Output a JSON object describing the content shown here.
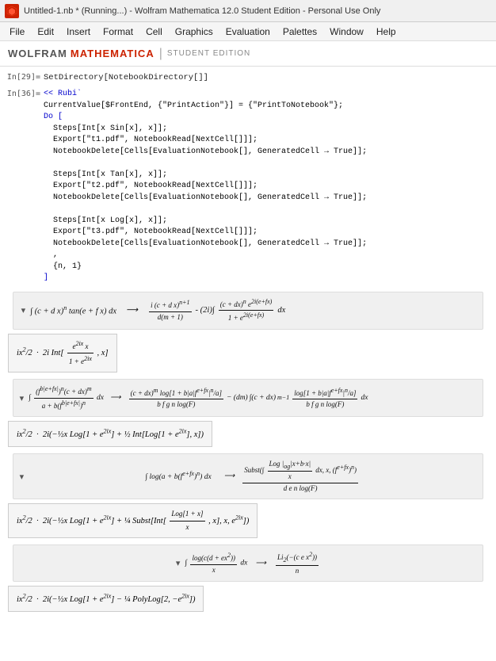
{
  "titleBar": {
    "title": "Untitled-1.nb * (Running...) - Wolfram Mathematica 12.0 Student Edition - Personal Use Only",
    "personalUse": "Personal Use Only"
  },
  "menuBar": {
    "items": [
      "File",
      "Edit",
      "Insert",
      "Format",
      "Cell",
      "Graphics",
      "Evaluation",
      "Palettes",
      "Window",
      "Help"
    ]
  },
  "wolframHeader": {
    "wolfram": "WOLFRAM",
    "mathematica": "MATHEMATICA",
    "separator": "|",
    "edition": "STUDENT EDITION"
  },
  "cells": [
    {
      "label": "In[29]=",
      "code": "SetDirectory[NotebookDirectory[]]"
    },
    {
      "label": "In[36]=",
      "code": "<< Rubi`\nCurrentValue[$FrontEnd, {\"PrintAction\"}] = {\"PrintToNotebook\"};\nDo[\n  Steps[Int[x Sin[x], x]];\n  Export[\"t1.pdf\", NotebookRead[NextCell[]]];\n  NotebookDelete[Cells[EvaluationNotebook[], GeneratedCell -> True]];\n\n  Steps[Int[x Tan[x], x]];\n  Export[\"t2.pdf\", NotebookRead[NextCell[]]];\n  NotebookDelete[Cells[EvaluationNotebook[], GeneratedCell -> True]];\n\n  Steps[Int[x Log[x], x]];\n  Export[\"t3.pdf\", NotebookRead[NextCell[]]];\n  NotebookDelete[Cells[EvaluationNotebook[], GeneratedCell -> True]];\n  ,\n  {n, 1}\n]"
    }
  ],
  "mathOutputs": [
    {
      "id": "out1",
      "type": "chevron",
      "left": "∫ (c + d x)ⁿ tan(e + f x) dx",
      "arrow": "→",
      "right1": "i (c + d x)ⁿ⁺¹ / (d(m+1)) - (2i) ∫ (c+dx)ⁿ e²ⁱ⁽ᵉ⁺ᶠˣ⁾ / (1 + e²ⁱ⁽ᵉ⁺ᶠˣ⁾) dx"
    },
    {
      "id": "out1b",
      "type": "small-box",
      "content": "ix²/2 · 2i Int[e²ⁱˣ x / (1 + e²ⁱˣ), x]"
    },
    {
      "id": "out2",
      "type": "chevron",
      "left": "∫ (fᵇ|ᵉ⁺ᶠˣ|)ⁿ (c+dx)ᵐ / (a + b(fᵇ|ᵉ⁺ᶠˣ|)ⁿ) dx",
      "arrow": "→",
      "right1": "(c+dx)ᵐ log[1 + b|a|fᵉ⁺ᶠˣ|ⁿ/a] / bfgn log(F) - (dm) ∫(c+dx)ᵐ⁻¹ log[...] dx / bfgn log(F)"
    },
    {
      "id": "out2b",
      "type": "small-box",
      "content": "ix²/2 · 2i(-½ x Log[1+e²ⁱˣ] + ½ Int[Log[1+e²ⁱˣ], x])"
    },
    {
      "id": "out3",
      "type": "chevron",
      "left": "∫ log(a + b(fᵉ⁺ᶠˣ|)ⁿ) dx",
      "arrow": "→",
      "right1": "Subst(∫ Log(|og|x+b·x|/x) dx, x, (fᵉ⁺ᶠˣ)ⁿ) / den log(F)"
    },
    {
      "id": "out3b",
      "type": "small-box",
      "content": "ix²/2 · 2i(-½ x Log[1+e²ⁱˣ] + ¼ Subst[Int[Log[1+x]/x, x], x, e²ⁱˣ])"
    },
    {
      "id": "out4",
      "type": "chevron",
      "left": "∫ log(c(d+eˣ²)) / x dx",
      "arrow": "→",
      "right1": "Li₂(-( c e x²)) / n"
    },
    {
      "id": "out4b",
      "type": "small-box",
      "content": "ix²/2 · 2i(-½ x Log[1+e²ⁱˣ] - ¼ PolyLog[2, -e²ⁱˣ])"
    }
  ]
}
